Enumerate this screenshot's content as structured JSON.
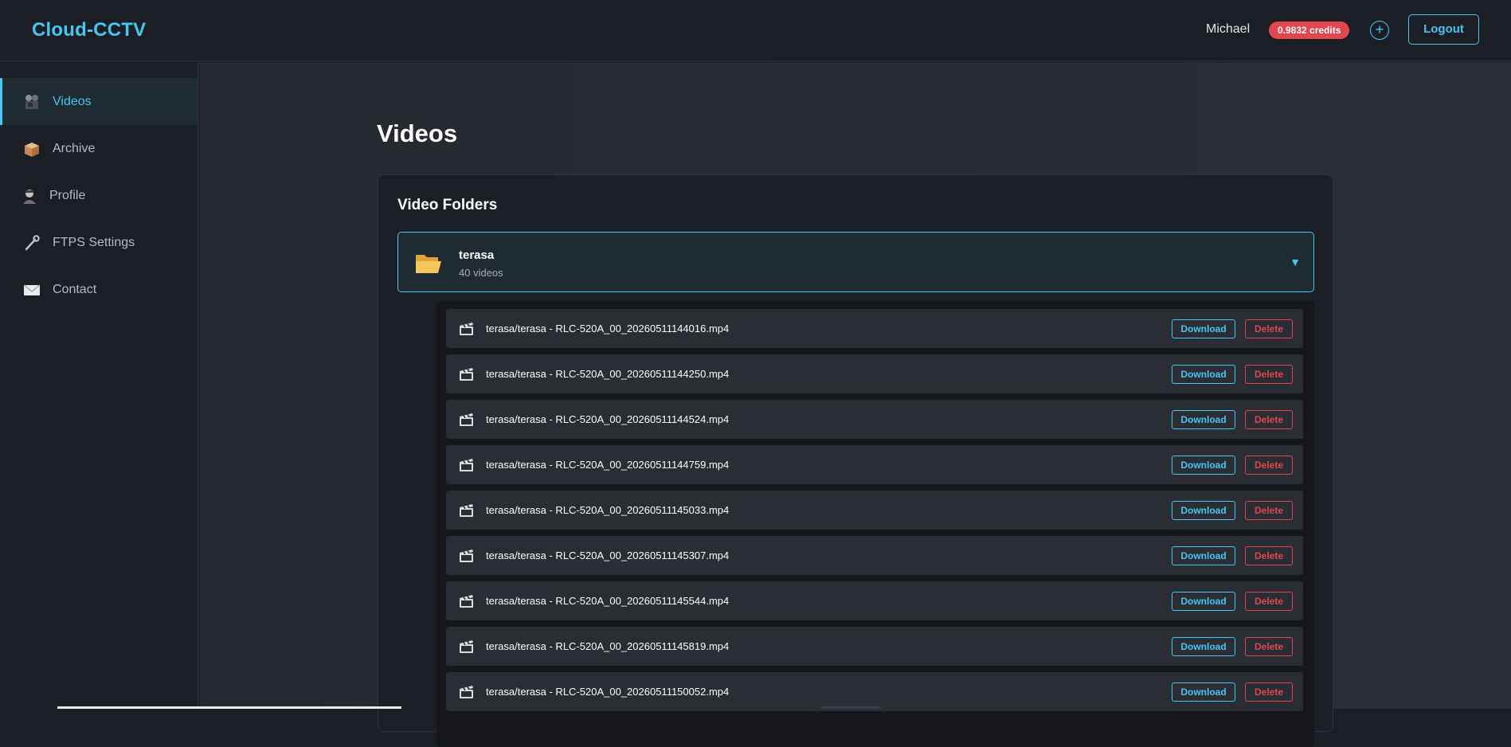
{
  "app": {
    "brand": "Cloud-CCTV",
    "user_name": "Michael",
    "credits": "0.9832 credits",
    "add_credits_symbol": "+",
    "logout_label": "Logout"
  },
  "colors": {
    "accent": "#45c7ef",
    "danger": "#e0474f",
    "background": "#1b1e24"
  },
  "sidebar": {
    "items": [
      {
        "label": "Videos",
        "icon": "film-camera-icon",
        "active": true
      },
      {
        "label": "Archive",
        "icon": "box-icon",
        "active": false
      },
      {
        "label": "Profile",
        "icon": "user-icon",
        "active": false
      },
      {
        "label": "FTPS Settings",
        "icon": "wrench-icon",
        "active": false
      },
      {
        "label": "Contact",
        "icon": "envelope-icon",
        "active": false
      }
    ]
  },
  "main": {
    "title": "Videos",
    "panel_title": "Video Folders",
    "folder": {
      "name": "terasa",
      "count": "40 videos",
      "toggle": "▼",
      "icon": "open-folder-icon"
    },
    "row_actions": {
      "download": "Download",
      "delete": "Delete"
    },
    "videos": [
      "terasa/terasa - RLC-520A_00_20260511144016.mp4",
      "terasa/terasa - RLC-520A_00_20260511144250.mp4",
      "terasa/terasa - RLC-520A_00_20260511144524.mp4",
      "terasa/terasa - RLC-520A_00_20260511144759.mp4",
      "terasa/terasa - RLC-520A_00_20260511145033.mp4",
      "terasa/terasa - RLC-520A_00_20260511145307.mp4",
      "terasa/terasa - RLC-520A_00_20260511145544.mp4",
      "terasa/terasa - RLC-520A_00_20260511145819.mp4",
      "terasa/terasa - RLC-520A_00_20260511150052.mp4"
    ]
  }
}
